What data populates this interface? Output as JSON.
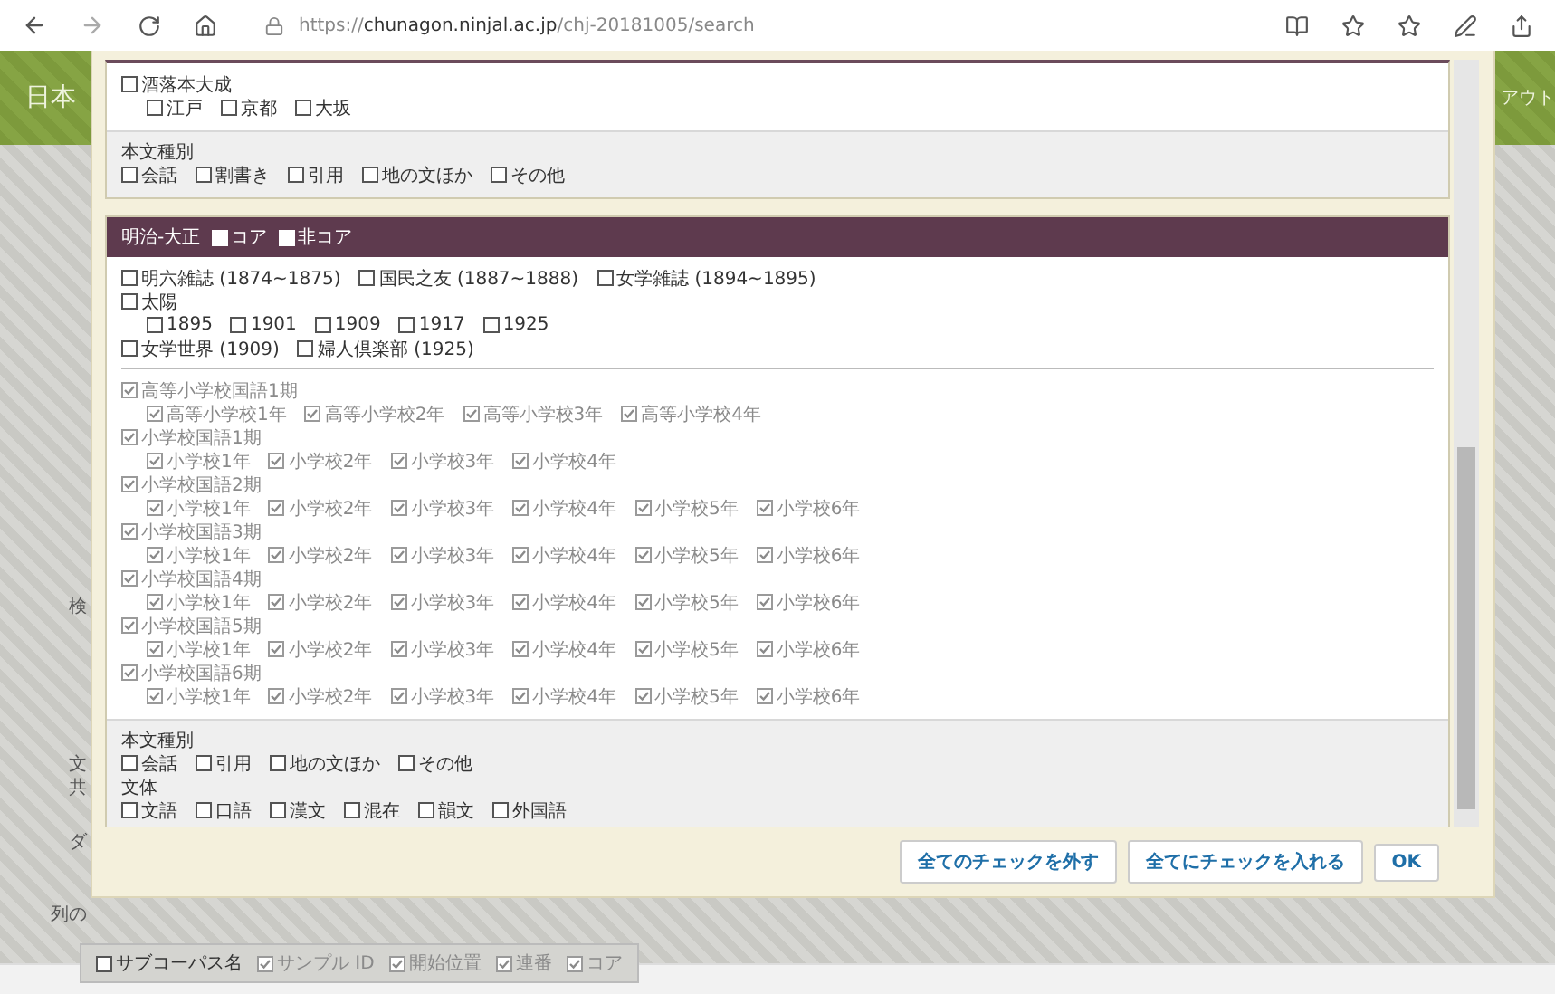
{
  "browser": {
    "url": "https://**chunagon.ninjal.ac.jp**/chj-20181005/search"
  },
  "background": {
    "banner_title": "日本",
    "banner_right": "アウト",
    "side_labels": [
      "検",
      "文",
      "共",
      "ダ"
    ],
    "column_label": "列の",
    "column_options": [
      {
        "label": "サブコーパス名",
        "checked": false
      },
      {
        "label": "サンプル ID",
        "checked": true
      },
      {
        "label": "開始位置",
        "checked": true
      },
      {
        "label": "連番",
        "checked": true
      },
      {
        "label": "コア",
        "checked": true
      }
    ]
  },
  "dialog": {
    "edo_section": {
      "groups": [
        {
          "label": "酒落本大成",
          "checked": false,
          "children": [
            {
              "label": "江戸",
              "checked": false
            },
            {
              "label": "京都",
              "checked": false
            },
            {
              "label": "大坂",
              "checked": false
            }
          ]
        }
      ],
      "text_type": {
        "label": "本文種別",
        "options": [
          {
            "label": "会話",
            "checked": false
          },
          {
            "label": "割書き",
            "checked": false
          },
          {
            "label": "引用",
            "checked": false
          },
          {
            "label": "地の文ほか",
            "checked": false
          },
          {
            "label": "その他",
            "checked": false
          }
        ]
      }
    },
    "meiji_section": {
      "title": "明治-大正",
      "header_options": [
        {
          "label": "コア",
          "checked": false
        },
        {
          "label": "非コア",
          "checked": false
        }
      ],
      "magazine_rows": [
        [
          {
            "label": "明六雑誌 (1874~1875)",
            "checked": false
          },
          {
            "label": "国民之友 (1887~1888)",
            "checked": false
          },
          {
            "label": "女学雑誌 (1894~1895)",
            "checked": false
          }
        ],
        [
          {
            "label": "太陽",
            "checked": false,
            "children": [
              {
                "label": "1895",
                "checked": false
              },
              {
                "label": "1901",
                "checked": false
              },
              {
                "label": "1909",
                "checked": false
              },
              {
                "label": "1917",
                "checked": false
              },
              {
                "label": "1925",
                "checked": false
              }
            ]
          }
        ],
        [
          {
            "label": "女学世界 (1909)",
            "checked": false
          },
          {
            "label": "婦人倶楽部 (1925)",
            "checked": false
          }
        ]
      ],
      "textbooks": [
        {
          "label": "高等小学校国語1期",
          "checked": true,
          "children": [
            {
              "label": "高等小学校1年",
              "checked": true
            },
            {
              "label": "高等小学校2年",
              "checked": true
            },
            {
              "label": "高等小学校3年",
              "checked": true
            },
            {
              "label": "高等小学校4年",
              "checked": true
            }
          ]
        },
        {
          "label": "小学校国語1期",
          "checked": true,
          "children": [
            {
              "label": "小学校1年",
              "checked": true
            },
            {
              "label": "小学校2年",
              "checked": true
            },
            {
              "label": "小学校3年",
              "checked": true
            },
            {
              "label": "小学校4年",
              "checked": true
            }
          ]
        },
        {
          "label": "小学校国語2期",
          "checked": true,
          "children": [
            {
              "label": "小学校1年",
              "checked": true
            },
            {
              "label": "小学校2年",
              "checked": true
            },
            {
              "label": "小学校3年",
              "checked": true
            },
            {
              "label": "小学校4年",
              "checked": true
            },
            {
              "label": "小学校5年",
              "checked": true
            },
            {
              "label": "小学校6年",
              "checked": true
            }
          ]
        },
        {
          "label": "小学校国語3期",
          "checked": true,
          "children": [
            {
              "label": "小学校1年",
              "checked": true
            },
            {
              "label": "小学校2年",
              "checked": true
            },
            {
              "label": "小学校3年",
              "checked": true
            },
            {
              "label": "小学校4年",
              "checked": true
            },
            {
              "label": "小学校5年",
              "checked": true
            },
            {
              "label": "小学校6年",
              "checked": true
            }
          ]
        },
        {
          "label": "小学校国語4期",
          "checked": true,
          "children": [
            {
              "label": "小学校1年",
              "checked": true
            },
            {
              "label": "小学校2年",
              "checked": true
            },
            {
              "label": "小学校3年",
              "checked": true
            },
            {
              "label": "小学校4年",
              "checked": true
            },
            {
              "label": "小学校5年",
              "checked": true
            },
            {
              "label": "小学校6年",
              "checked": true
            }
          ]
        },
        {
          "label": "小学校国語5期",
          "checked": true,
          "children": [
            {
              "label": "小学校1年",
              "checked": true
            },
            {
              "label": "小学校2年",
              "checked": true
            },
            {
              "label": "小学校3年",
              "checked": true
            },
            {
              "label": "小学校4年",
              "checked": true
            },
            {
              "label": "小学校5年",
              "checked": true
            },
            {
              "label": "小学校6年",
              "checked": true
            }
          ]
        },
        {
          "label": "小学校国語6期",
          "checked": true,
          "children": [
            {
              "label": "小学校1年",
              "checked": true
            },
            {
              "label": "小学校2年",
              "checked": true
            },
            {
              "label": "小学校3年",
              "checked": true
            },
            {
              "label": "小学校4年",
              "checked": true
            },
            {
              "label": "小学校5年",
              "checked": true
            },
            {
              "label": "小学校6年",
              "checked": true
            }
          ]
        }
      ],
      "filters": [
        {
          "label": "本文種別",
          "options": [
            {
              "label": "会話",
              "checked": false
            },
            {
              "label": "引用",
              "checked": false
            },
            {
              "label": "地の文ほか",
              "checked": false
            },
            {
              "label": "その他",
              "checked": false
            }
          ]
        },
        {
          "label": "文体",
          "options": [
            {
              "label": "文語",
              "checked": false
            },
            {
              "label": "口語",
              "checked": false
            },
            {
              "label": "漢文",
              "checked": false
            },
            {
              "label": "混在",
              "checked": false
            },
            {
              "label": "韻文",
              "checked": false
            },
            {
              "label": "外国語",
              "checked": false
            }
          ]
        }
      ]
    },
    "buttons": [
      "全てのチェックを外す",
      "全てにチェックを入れる",
      "OK"
    ]
  }
}
